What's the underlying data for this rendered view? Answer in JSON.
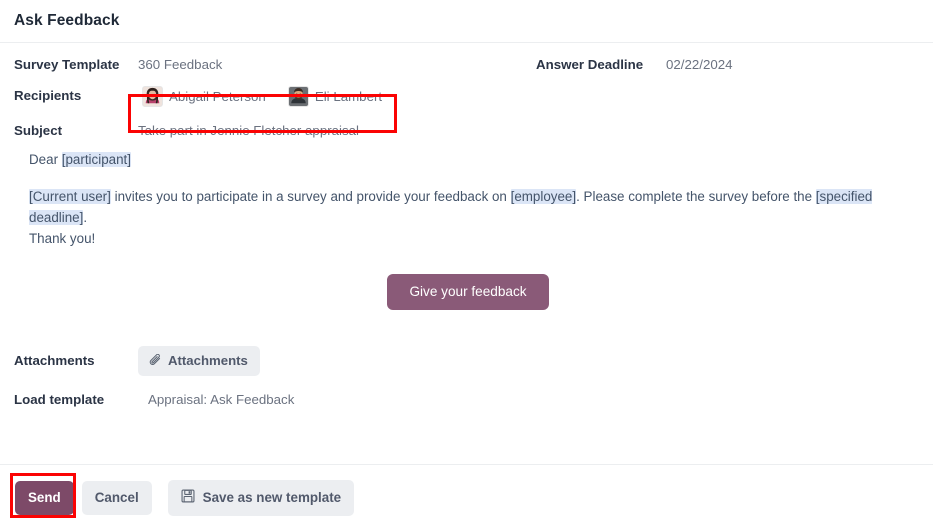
{
  "dialog": {
    "title": "Ask Feedback"
  },
  "fields": {
    "survey_template": {
      "label": "Survey Template",
      "value": "360 Feedback"
    },
    "answer_deadline": {
      "label": "Answer Deadline",
      "value": "02/22/2024"
    },
    "recipients": {
      "label": "Recipients",
      "items": [
        {
          "name": "Abigail Peterson",
          "avatar": "woman-photo-avatar"
        },
        {
          "name": "Eli Lambert",
          "avatar": "man-photo-avatar"
        }
      ]
    },
    "subject": {
      "label": "Subject",
      "value": "Take part in Jennie Fletcher appraisal"
    },
    "attachments": {
      "label": "Attachments",
      "button_label": "Attachments",
      "icon": "paperclip-icon"
    },
    "load_template": {
      "label": "Load template",
      "value": "Appraisal: Ask Feedback"
    }
  },
  "mail": {
    "greeting_prefix": "Dear ",
    "greeting_placeholder": "[participant]",
    "para": {
      "ph_current_user": "[Current user]",
      "t1": " invites you to participate in a survey and provide your feedback on ",
      "ph_employee": "[employee]",
      "t2": ". Please complete the survey before the ",
      "ph_deadline": "[specified deadline]",
      "t3": "."
    },
    "thanks": "Thank you!",
    "cta_label": "Give your feedback"
  },
  "footer": {
    "send_label": "Send",
    "cancel_label": "Cancel",
    "save_template_label": "Save as new template",
    "save_icon": "floppy-disk-icon"
  },
  "colors": {
    "brand_purple": "#8a5a78",
    "send_purple": "#7d4a68",
    "placeholder_highlight": "#dbe5f6",
    "annotation_red": "#fb0303",
    "soft_button_bg": "#eceef1"
  }
}
